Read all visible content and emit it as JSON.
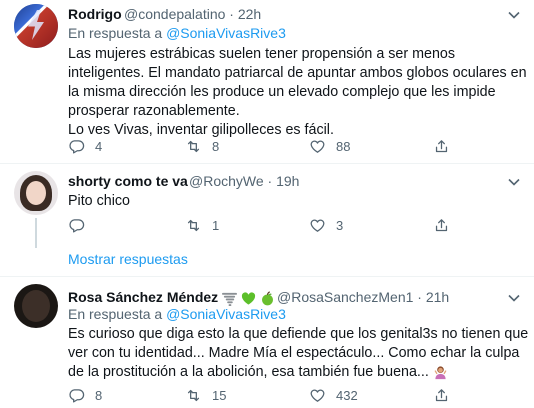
{
  "tweets": [
    {
      "name": "Rodrigo",
      "handle": "@condepalatino",
      "separator": "·",
      "time": "22h",
      "reply_prefix": "En respuesta a",
      "reply_to": "@SoniaVivasRive3",
      "text_lines": [
        "Las mujeres estrábicas suelen tener propensión a ser menos",
        "inteligentes. El mandato patriarcal de apuntar ambos globos oculares en",
        "la misma dirección les produce un elevado complejo que les impide",
        "prosperar razonablemente.",
        "Lo ves Vivas, inventar gilipolleces es fácil."
      ],
      "replies": "4",
      "retweets": "8",
      "likes": "88"
    },
    {
      "name": "shorty como te va",
      "handle": "@RochyWe",
      "separator": "·",
      "time": "19h",
      "text": "Pito chico",
      "replies": "",
      "retweets": "1",
      "likes": "3"
    },
    {
      "name": "Rosa Sánchez Méndez",
      "handle": "@RosaSanchezMen1",
      "separator": "·",
      "time": "21h",
      "reply_prefix": "En respuesta a",
      "reply_to": "@SoniaVivasRive3",
      "text_lines": [
        "Es curioso que diga esto la que defiende que los genital3s no tienen que",
        "ver con tu identidad... Madre Mía el espectáculo... Como echar la culpa",
        "de la prostitución a la abolición, esa también fue buena..."
      ],
      "replies": "8",
      "retweets": "15",
      "likes": "432"
    }
  ],
  "show_more_label": "Mostrar respuestas",
  "icons": [
    "reply-icon",
    "retweet-icon",
    "like-icon",
    "share-icon",
    "more-caret-icon",
    "tornado-emoji",
    "green-heart-emoji",
    "green-apple-emoji",
    "person-gesturing-emoji"
  ],
  "colors": {
    "link": "#1d9bf0",
    "secondary": "#536471",
    "text": "#0f1419",
    "divider": "#eff3f4"
  }
}
